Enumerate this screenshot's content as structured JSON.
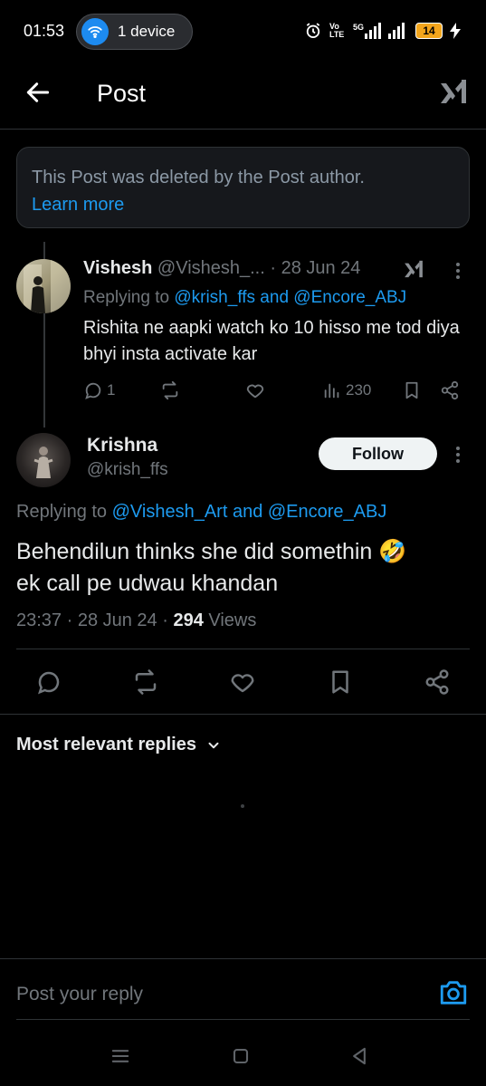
{
  "status_bar": {
    "time": "01:53",
    "device_label": "1 device",
    "signal_text": "Vo LTE",
    "network": "5G",
    "battery": "14"
  },
  "header": {
    "title": "Post",
    "back_icon": "arrow-left-icon",
    "logo_icon": "xai-grok-icon"
  },
  "deleted_notice": {
    "text": "This Post was deleted by the Post author.",
    "link": "Learn more"
  },
  "reply_tweet": {
    "name": "Vishesh",
    "handle": "@Vishesh_...",
    "time": "· 28 Jun 24",
    "replying_prefix": "Replying to",
    "replying_to": "@krish_ffs and @Encore_ABJ",
    "body": "Rishita ne aapki watch ko 10 hisso me tod diya bhyi insta activate kar",
    "actions": {
      "replies": "1",
      "views": "230"
    }
  },
  "main_tweet": {
    "name": "Krishna",
    "handle": "@krish_ffs",
    "follow_label": "Follow",
    "replying_prefix": "Replying to",
    "replying_to": "@Vishesh_Art and @Encore_ABJ",
    "body_line1": "Behendilun thinks she did somethin 🤣",
    "body_line2": "ek call pe udwau khandan",
    "time": "23:37 · 28 Jun 24 · ",
    "views_count": "294",
    "views_label": " Views"
  },
  "replies_section": {
    "sort_label": "Most relevant replies"
  },
  "composer": {
    "placeholder": "Post your reply"
  },
  "colors": {
    "accent": "#1d9bf0",
    "background": "#000000",
    "muted": "#71767b",
    "divider": "#2f3336"
  }
}
